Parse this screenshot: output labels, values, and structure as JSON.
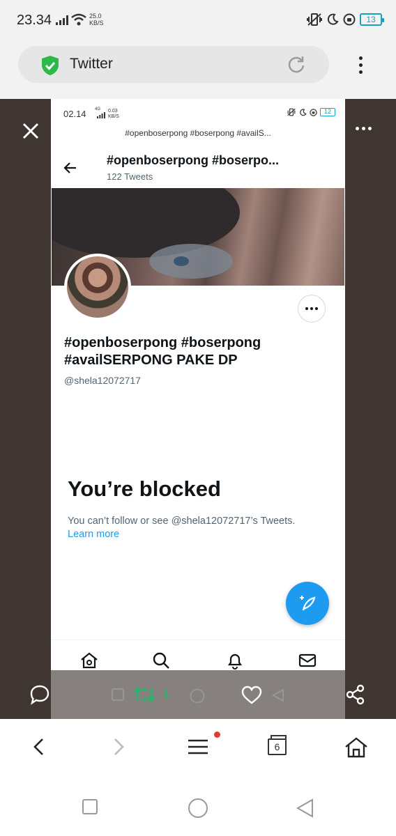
{
  "status_bar": {
    "time": "23.34",
    "speed_value": "25.0",
    "speed_unit": "KB/S",
    "battery": "13",
    "icons": [
      "signal-icon",
      "wifi-icon",
      "vibrate-icon",
      "moon-icon",
      "alarm-icon",
      "battery-icon"
    ]
  },
  "browser": {
    "url_label": "Twitter",
    "icons": [
      "shield-check-icon",
      "reload-icon",
      "kebab-menu-icon"
    ]
  },
  "viewer": {
    "icons": [
      "close-icon",
      "more-horizontal-icon",
      "comment-icon",
      "retweet-icon",
      "like-icon",
      "share-icon"
    ],
    "retweet_count": "1"
  },
  "screenshot": {
    "status": {
      "time": "02.14",
      "network": "4G",
      "speed_value": "0.03",
      "speed_unit": "KB/S",
      "battery": "12"
    },
    "url_text": "#openboserpong #boserpong #availS...",
    "header": {
      "title": "#openboserpong #boserpo...",
      "tweet_count": "122 Tweets"
    },
    "profile": {
      "display_name": "#openboserpong #boserpong #availSERPONG PAKE DP",
      "handle": "@shela12072717"
    },
    "blocked": {
      "title": "You’re blocked",
      "description": "You can’t follow or see @shela12072717’s Tweets.",
      "learn_more": "Learn more"
    },
    "bottom_nav": [
      "home-icon",
      "search-icon",
      "notifications-icon",
      "messages-icon"
    ]
  },
  "browser_toolbar": {
    "tabs_count": "6",
    "icons": [
      "back-icon",
      "forward-icon",
      "menu-icon",
      "tabs-icon",
      "home-icon"
    ]
  },
  "colors": {
    "twitter_blue": "#1d9bf0",
    "retweet_green": "#26b36b",
    "viewer_bg": "#3f3531",
    "shield_green": "#2db84c",
    "battery_teal": "#16a3b8"
  }
}
